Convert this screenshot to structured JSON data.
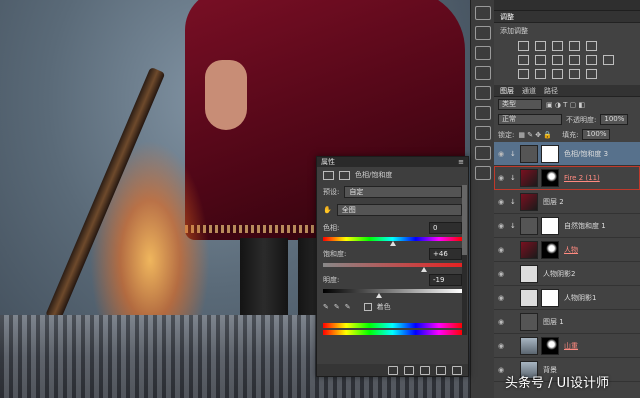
{
  "adjustments_panel": {
    "tab": "调整",
    "title": "添加调整"
  },
  "layers_panel": {
    "tabs": [
      "图层",
      "通道",
      "路径"
    ],
    "filter_select": "类型",
    "blend_mode": "正常",
    "opacity_label": "不透明度:",
    "opacity_value": "100%",
    "lock_label": "锁定:",
    "fill_label": "填充:",
    "fill_value": "100%",
    "layers": [
      {
        "name": "色相/饱和度 3",
        "selected": true
      },
      {
        "name": "Fire 2 (11)",
        "highlight": true
      },
      {
        "name": "图层 2"
      },
      {
        "name": "自然饱和度 1"
      },
      {
        "name": "人物"
      },
      {
        "name": "人物阴影2"
      },
      {
        "name": "人物阴影1"
      },
      {
        "name": "图层 1"
      },
      {
        "name": "山重"
      },
      {
        "name": "背景"
      }
    ]
  },
  "properties_panel": {
    "tab": "属性",
    "title": "色相/饱和度",
    "preset_label": "预设:",
    "preset_value": "自定",
    "channel_value": "全图",
    "hue_label": "色相:",
    "hue_value": "0",
    "saturation_label": "饱和度:",
    "saturation_value": "+46",
    "lightness_label": "明度:",
    "lightness_value": "-19",
    "colorize_label": "着色",
    "slider_levels": {
      "hue": 0.5,
      "saturation": 0.73,
      "lightness": 0.4
    }
  },
  "watermark": "头条号 / UI设计师"
}
